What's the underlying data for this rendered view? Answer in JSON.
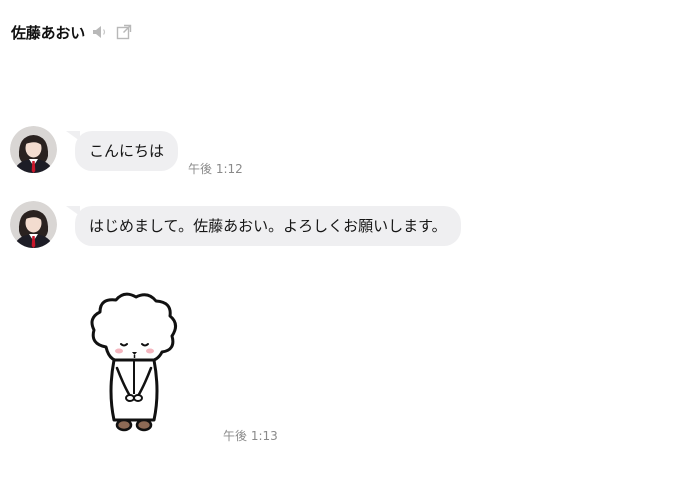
{
  "header": {
    "name": "佐藤あおい",
    "icons": [
      "speaker-icon",
      "popout-icon"
    ]
  },
  "messages": [
    {
      "text": "こんにちは",
      "time": "午後 1:12"
    },
    {
      "text": "はじめまして。佐藤あおい。よろしくお願いします。",
      "time": ""
    }
  ],
  "sticker": {
    "description_icon": "bowing-sheep-sticker",
    "time": "午後 1:13"
  }
}
